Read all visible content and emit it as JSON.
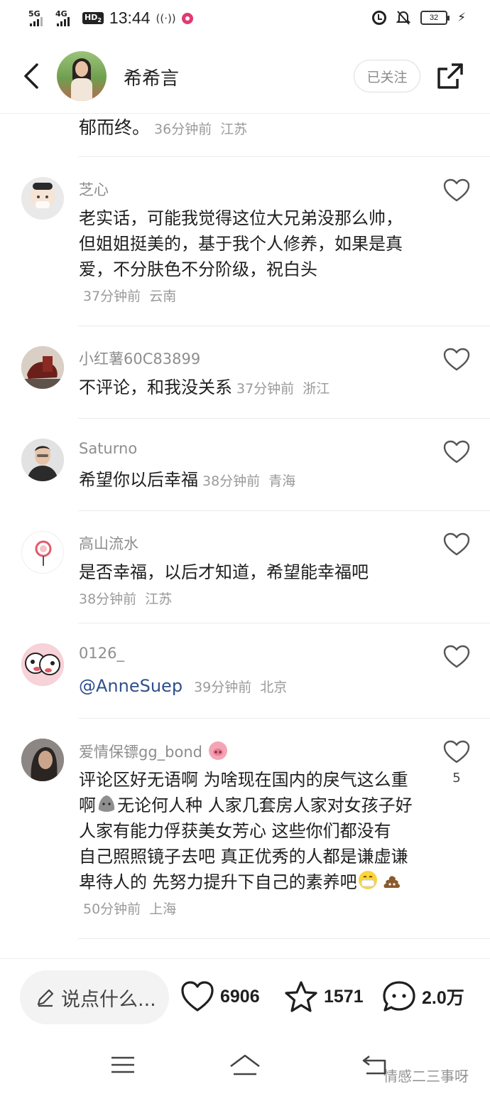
{
  "status_bar": {
    "network1": "5G",
    "network2": "4G",
    "hd_label": "HD",
    "hd_sub": "2",
    "time": "13:44",
    "battery": "32"
  },
  "header": {
    "name": "希希言",
    "follow_label": "已关注"
  },
  "comments": [
    {
      "user": "",
      "text": "郁而终。",
      "time": "36分钟前",
      "location": "江苏",
      "likes": ""
    },
    {
      "user": "芝心",
      "text": "老实话，可能我觉得这位大兄弟没那么帅，但姐姐挺美的，基于我个人修养，如果是真爱，不分肤色不分阶级，祝白头",
      "time": "37分钟前",
      "location": "云南",
      "likes": ""
    },
    {
      "user": "小红薯60C83899",
      "text": "不评论，和我没关系",
      "time": "37分钟前",
      "location": "浙江",
      "likes": ""
    },
    {
      "user": "Saturno",
      "text": "希望你以后幸福",
      "time": "38分钟前",
      "location": "青海",
      "likes": ""
    },
    {
      "user": "高山流水",
      "text": "是否幸福，以后才知道，希望能幸福吧",
      "time": "38分钟前",
      "location": "江苏",
      "likes": ""
    },
    {
      "user": "0126_",
      "text": "@AnneSuep",
      "time": "39分钟前",
      "location": "北京",
      "likes": ""
    },
    {
      "user": "爱情保镖gg_bond",
      "text_parts": [
        "评论区好无语啊 为啥现在国内的戾气这么重啊",
        "无论何人种 人家几套房人家对女孩子好人家有能力俘获美女芳心 这些你们都没有 自己照照镜子去吧 真正优秀的人都是谦虚谦卑待人的 先努力提升下自己的素养吧"
      ],
      "time": "50分钟前",
      "location": "上海",
      "likes": "5"
    }
  ],
  "action_bar": {
    "input_placeholder": "说点什么...",
    "like_count": "6906",
    "star_count": "1571",
    "comment_count": "2.0万"
  },
  "watermark": "情感二三事呀",
  "colors": {
    "meta_gray": "#9a9a9a",
    "mention_blue": "#2f4f8c",
    "text_dark": "#1f1f1f"
  }
}
